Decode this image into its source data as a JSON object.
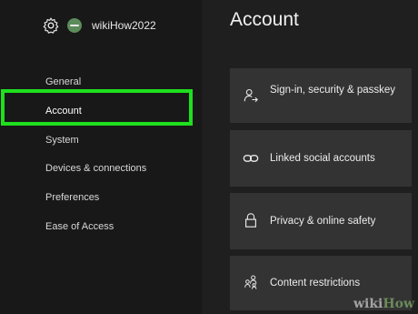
{
  "profile": {
    "settings_icon": "gear-icon",
    "gamertag": "wikiHow2022"
  },
  "sidebar": {
    "items": [
      {
        "label": "General"
      },
      {
        "label": "Account",
        "selected": true
      },
      {
        "label": "System"
      },
      {
        "label": "Devices & connections"
      },
      {
        "label": "Preferences"
      },
      {
        "label": "Ease of Access"
      }
    ]
  },
  "main": {
    "title": "Account",
    "cards": [
      {
        "label": "Sign-in, security & passkey",
        "icon": "person-arrow-icon"
      },
      {
        "label": "Linked social accounts",
        "icon": "link-icon"
      },
      {
        "label": "Privacy & online safety",
        "icon": "lock-icon"
      },
      {
        "label": "Content restrictions",
        "icon": "family-icon"
      }
    ]
  },
  "colors": {
    "highlight": "#1ee01e",
    "card_background": "#333333",
    "sidebar_background": "#181818"
  },
  "watermark": {
    "text_prefix": "wiki",
    "text_suffix": "How"
  }
}
